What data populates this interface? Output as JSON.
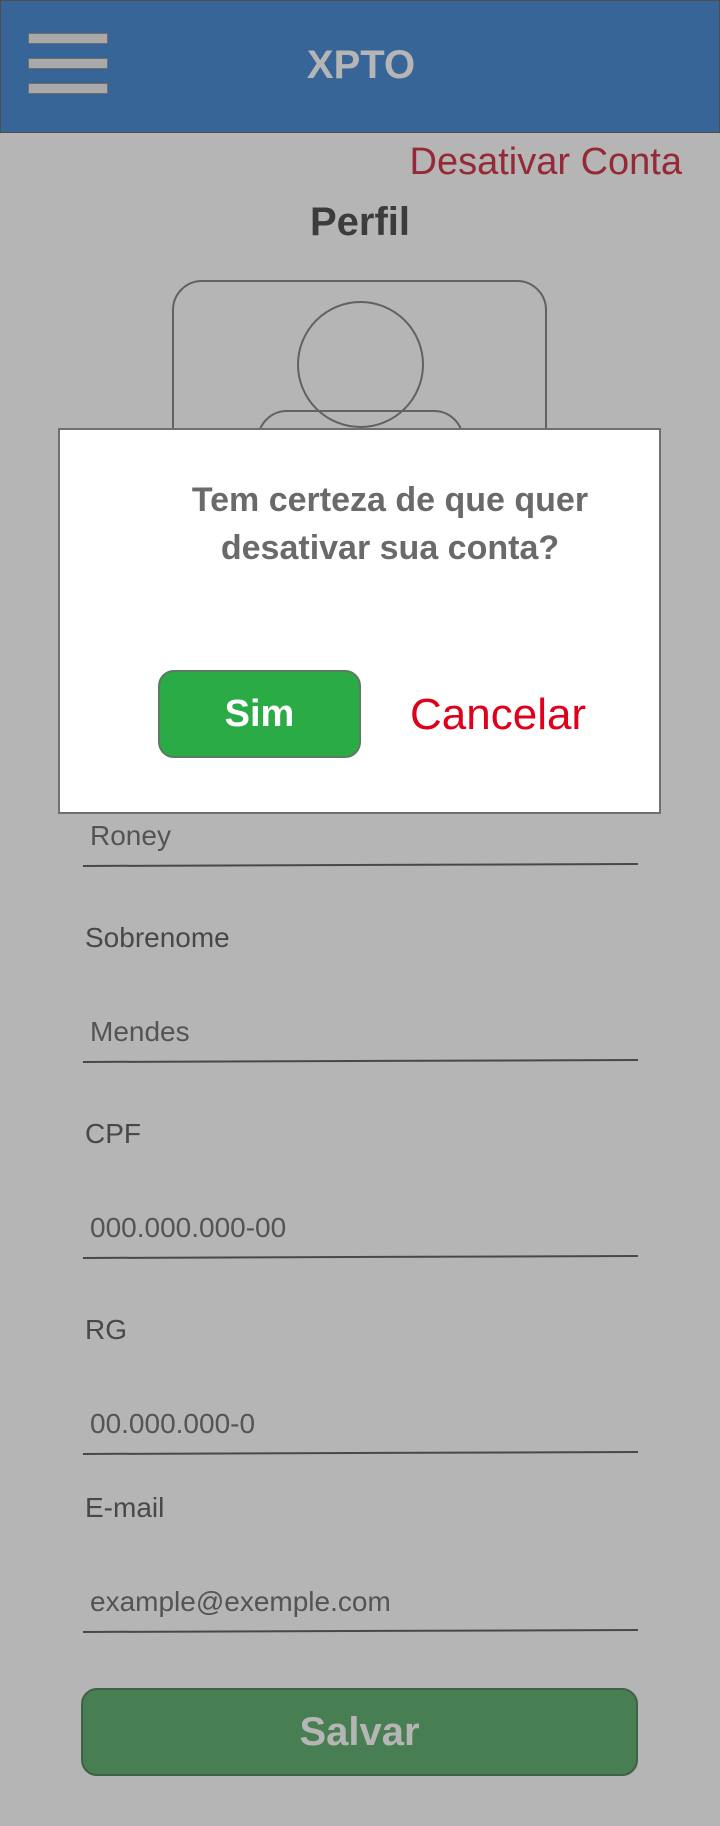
{
  "header": {
    "title": "XPTO",
    "menu_icon": "hamburger-menu-icon",
    "background": "#4f8fd6"
  },
  "deactivate_link": "Desativar Conta",
  "page_title": "Perfil",
  "avatar_icon": "user-avatar-icon",
  "form": {
    "first_name_value": "Roney",
    "last_name_label": "Sobrenome",
    "last_name_value": "Mendes",
    "cpf_label": "CPF",
    "cpf_value": "000.000.000-00",
    "rg_label": "RG",
    "rg_value": "00.000.000-0",
    "email_label": "E-mail",
    "email_value": "example@exemple.com",
    "save_label": "Salvar"
  },
  "modal": {
    "question_line1": "Tem certeza de que quer",
    "question_line2": "desativar sua conta?",
    "confirm_label": "Sim",
    "cancel_label": "Cancelar"
  },
  "colors": {
    "confirm": "#2aab45",
    "cancel": "#e0001b",
    "deactivate": "#d43a4d"
  }
}
